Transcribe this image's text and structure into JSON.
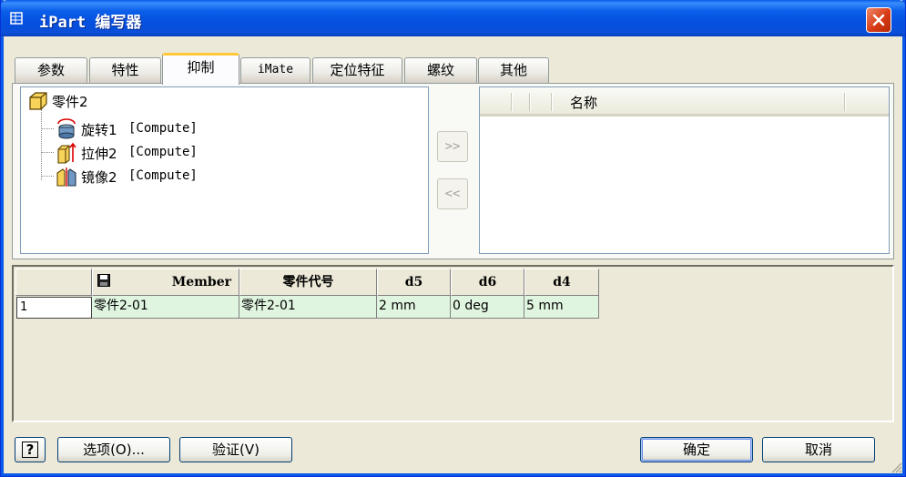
{
  "window": {
    "title": "iPart 编写器",
    "icon": "table-icon",
    "close_icon": "close-icon"
  },
  "tabs": [
    {
      "label": "参数",
      "active": false
    },
    {
      "label": "特性",
      "active": false
    },
    {
      "label": "抑制",
      "active": true
    },
    {
      "label": "iMate",
      "active": false
    },
    {
      "label": "定位特征",
      "active": false
    },
    {
      "label": "螺纹",
      "active": false
    },
    {
      "label": "其他",
      "active": false
    }
  ],
  "tree": {
    "root": {
      "label": "零件2",
      "icon": "part-cube-icon"
    },
    "items": [
      {
        "name": "旋转1",
        "tag": "[Compute]",
        "icon": "revolve-feature-icon"
      },
      {
        "name": "拉伸2",
        "tag": "[Compute]",
        "icon": "extrude-feature-icon"
      },
      {
        "name": "镜像2",
        "tag": "[Compute]",
        "icon": "mirror-feature-icon"
      }
    ]
  },
  "transfer": {
    "add_label": ">>",
    "remove_label": "<<"
  },
  "list": {
    "column_header": "名称"
  },
  "table": {
    "save_icon": "floppy-disk-icon",
    "columns": [
      "Member",
      "零件代号",
      "d5",
      "d6",
      "d4"
    ],
    "rows": [
      {
        "index": "1",
        "cells": [
          "零件2-01",
          "零件2-01",
          "2 mm",
          "0 deg",
          "5 mm"
        ]
      }
    ]
  },
  "buttons": {
    "help_label": "?",
    "options_label": "选项(O)...",
    "verify_label": "验证(V)",
    "ok_label": "确定",
    "cancel_label": "取消"
  },
  "colors": {
    "title_bar": "#0a5ae8",
    "close_button": "#d83a15",
    "grid_row": "#e0f5e0",
    "active_tab_accent": "#ffc83c"
  }
}
